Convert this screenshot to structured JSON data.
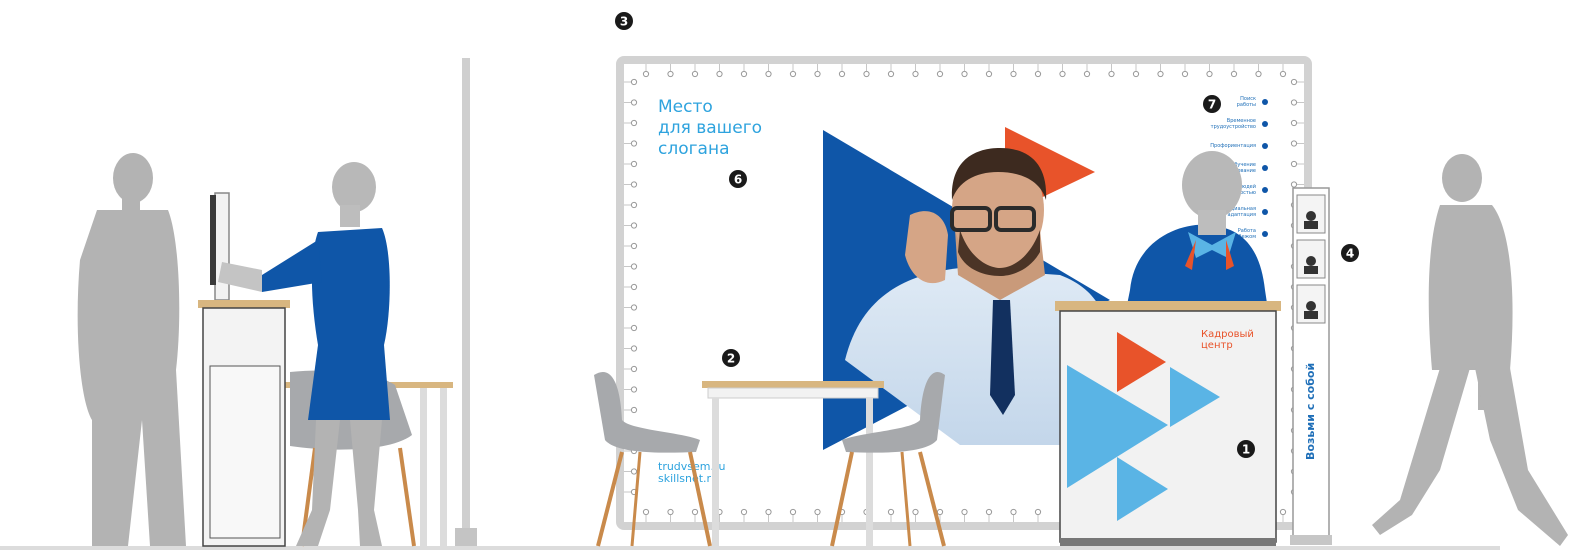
{
  "banner": {
    "slogan_lines": [
      "Место",
      "для вашего",
      "слогана"
    ],
    "url_lines": [
      "trudvsem.ru",
      "skillsnet.ru"
    ],
    "menu_items": [
      [
        "Поиск",
        "работы"
      ],
      [
        "Временное",
        "трудоустройство"
      ],
      [
        "Профориентация"
      ],
      [
        "Переобучение",
        "и образование"
      ],
      [
        "Занятость людей",
        "с инвалидностью"
      ],
      [
        "Социальная",
        "адаптация"
      ],
      [
        "Работа",
        "за рубежом"
      ]
    ]
  },
  "counter": {
    "title_lines": [
      "Кадровый",
      "центр"
    ]
  },
  "stand": {
    "label": "Возьми с собой"
  },
  "markers": [
    {
      "name": "marker-1",
      "label": "1"
    },
    {
      "name": "marker-2",
      "label": "2"
    },
    {
      "name": "marker-3",
      "label": "3"
    },
    {
      "name": "marker-4",
      "label": "4"
    },
    {
      "name": "marker-6",
      "label": "6"
    },
    {
      "name": "marker-7",
      "label": "7"
    }
  ],
  "colors": {
    "brand_blue": "#0f56a8",
    "light_blue": "#5ab4e5",
    "accent_orange": "#e8532a",
    "silhouette_gray": "#b3b3b3",
    "frame_gray": "#d2d2d2"
  }
}
